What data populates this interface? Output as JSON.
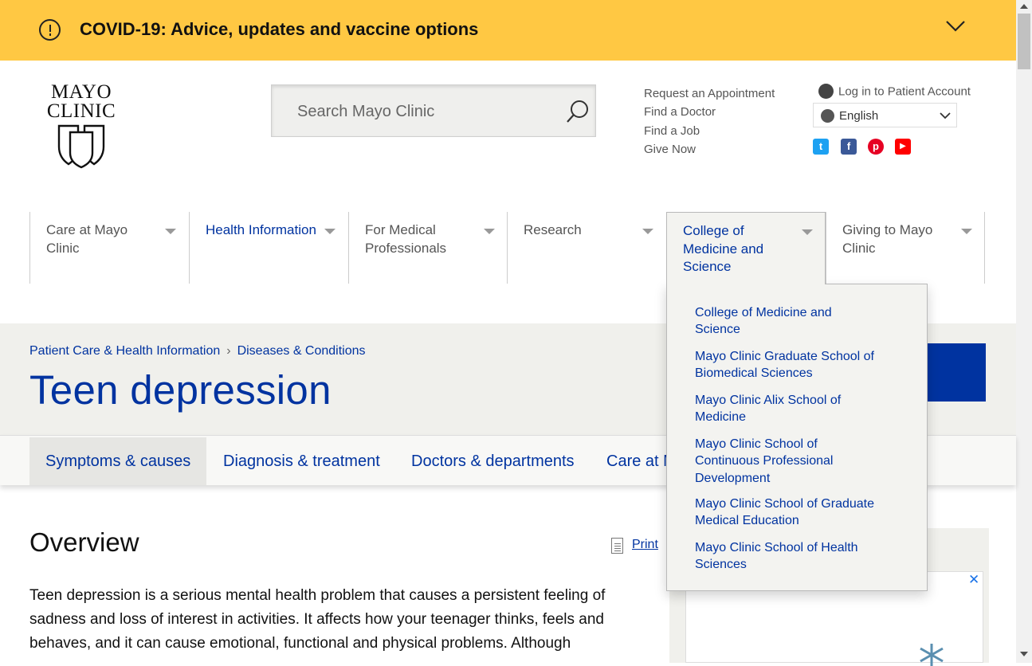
{
  "covid_banner": {
    "text": "COVID-19: Advice, updates and vaccine options"
  },
  "logo": {
    "line1": "MAYO",
    "line2": "CLINIC"
  },
  "search": {
    "placeholder": "Search Mayo Clinic"
  },
  "utility_links": [
    "Request an Appointment",
    "Find a Doctor",
    "Find a Job",
    "Give Now"
  ],
  "account": {
    "login_label": "Log in to Patient Account",
    "language": "English"
  },
  "social": [
    {
      "name": "twitter",
      "glyph": "t",
      "color": "#1da1f2"
    },
    {
      "name": "facebook",
      "glyph": "f",
      "color": "#3b5998"
    },
    {
      "name": "pinterest",
      "glyph": "p",
      "color": "#e60023"
    },
    {
      "name": "youtube",
      "glyph": "▶",
      "color": "#ff0000"
    }
  ],
  "nav": [
    {
      "label": "Care at Mayo Clinic"
    },
    {
      "label": "Health Information"
    },
    {
      "label": "For Medical Professionals"
    },
    {
      "label": "Research"
    },
    {
      "label": "College of Medicine and Science"
    },
    {
      "label": "Giving to Mayo Clinic"
    }
  ],
  "dropdown": [
    "College of Medicine and Science",
    "Mayo Clinic Graduate School of Biomedical Sciences",
    "Mayo Clinic Alix School of Medicine",
    "Mayo Clinic School of Continuous Professional Development",
    "Mayo Clinic School of Graduate Medical Education",
    "Mayo Clinic School of Health Sciences"
  ],
  "breadcrumb": [
    "Patient Care & Health Information",
    "Diseases & Conditions"
  ],
  "page_title": "Teen depression",
  "tabs": [
    "Symptoms & causes",
    "Diagnosis & treatment",
    "Doctors & departments",
    "Care at M"
  ],
  "overview": {
    "title": "Overview",
    "print_label": "Print",
    "text": "Teen depression is a serious mental health problem that causes a persistent feeling of sadness and loss of interest in activities. It affects how your teenager thinks, feels and behaves, and it can cause emotional, functional and physical problems. Although"
  },
  "ad": {
    "close_glyph": "✕"
  },
  "colors": {
    "banner": "#ffc843",
    "brand_blue": "#0033a0"
  }
}
